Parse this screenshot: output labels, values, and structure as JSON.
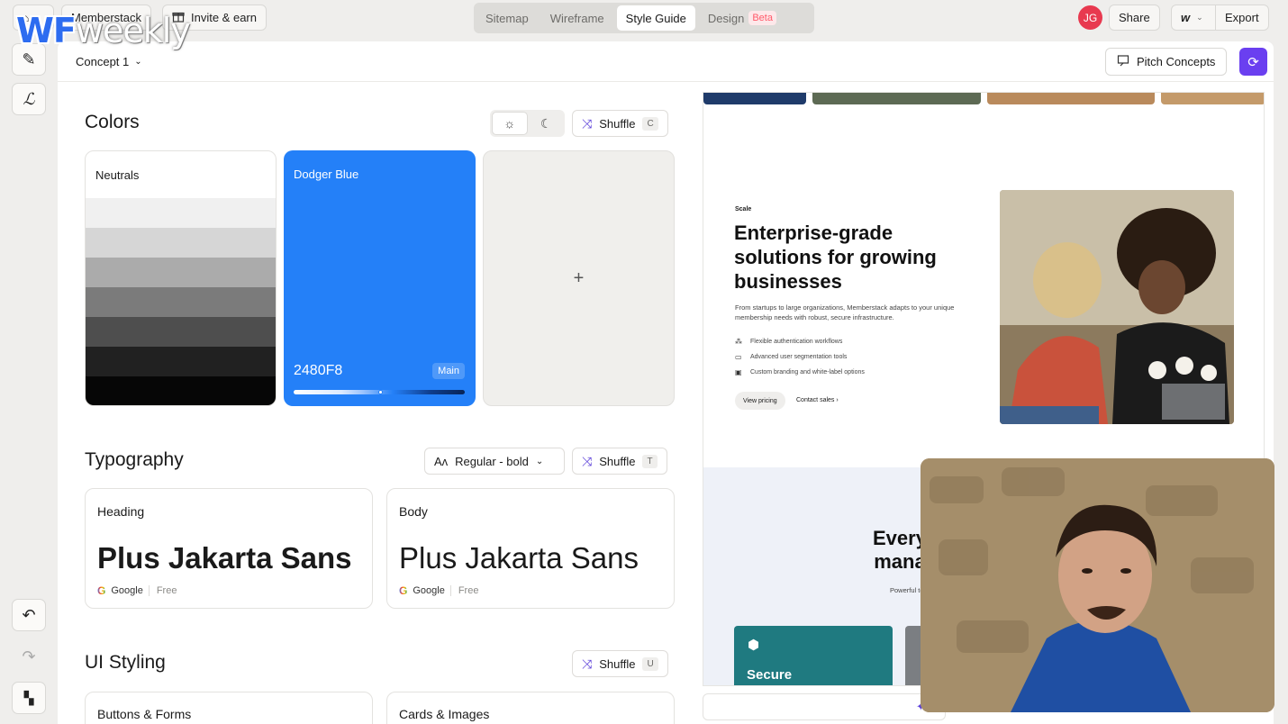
{
  "overlay": {
    "logo_a": "WF",
    "logo_b": "weekly"
  },
  "topbar": {
    "workspace": "Memberstack",
    "invite": "Invite & earn",
    "tabs": [
      {
        "label": "Sitemap"
      },
      {
        "label": "Wireframe"
      },
      {
        "label": "Style Guide",
        "active": true
      },
      {
        "label": "Design",
        "badge": "Beta"
      }
    ],
    "avatar_initials": "JG",
    "share": "Share",
    "export": "Export"
  },
  "subbar": {
    "concept": "Concept 1",
    "pitch": "Pitch Concepts"
  },
  "colors": {
    "title": "Colors",
    "shuffle": "Shuffle",
    "shuffle_key": "C",
    "neutrals_label": "Neutrals",
    "neutrals": [
      "#f0f0f0",
      "#d6d6d6",
      "#ababab",
      "#7b7b7b",
      "#4e4e4e",
      "#212121",
      "#060606"
    ],
    "primary_label": "Dodger Blue",
    "primary_hex": "2480F8",
    "primary_tag": "Main",
    "add": "+"
  },
  "typography": {
    "title": "Typography",
    "weight": "Regular - bold",
    "shuffle": "Shuffle",
    "shuffle_key": "T",
    "heading_label": "Heading",
    "heading_font": "Plus Jakarta Sans",
    "body_label": "Body",
    "body_font": "Plus Jakarta Sans",
    "source": "Google",
    "license": "Free"
  },
  "ui_styling": {
    "title": "UI Styling",
    "shuffle": "Shuffle",
    "shuffle_key": "U",
    "cards": [
      "Buttons & Forms",
      "Cards & Images"
    ]
  },
  "preview": {
    "tag": "Scale",
    "headline": "Enterprise-grade solutions for growing businesses",
    "paragraph": "From startups to large organizations, Memberstack adapts to your unique membership needs with robust, secure infrastructure.",
    "bullets": [
      "Flexible authentication workflows",
      "Advanced user segmentation tools",
      "Custom branding and white-label options"
    ],
    "primary_cta": "View pricing",
    "secondary_cta": "Contact sales",
    "section2_line1": "Every",
    "section2_line2": "mana",
    "section2_sub": "Powerful tools de",
    "feature_card": "Secure"
  },
  "theme": {
    "accent": "#6a3ff0",
    "primary": "#2480F8",
    "avatar": "#e8394f",
    "beta": "#ff5a6a"
  }
}
